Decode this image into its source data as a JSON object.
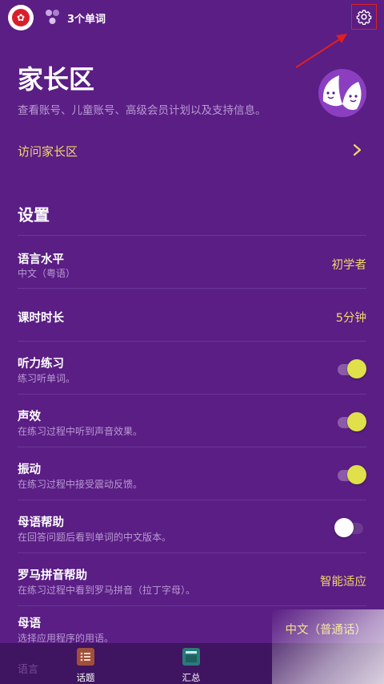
{
  "topbar": {
    "flag_glyph": "✿",
    "words_count": "3个单词",
    "icons": [
      "flag-icon",
      "words-icon",
      "gear-icon"
    ]
  },
  "parent": {
    "title": "家长区",
    "description": "查看账号、儿童账号、高级会员计划以及支持信息。",
    "link_label": "访问家长区"
  },
  "settings": {
    "title": "设置",
    "rows": [
      {
        "title": "语言水平",
        "subtitle": "中文（粤语）",
        "value": "初学者"
      },
      {
        "title": "课时时长",
        "subtitle": "",
        "value": "5分钟"
      },
      {
        "title": "听力练习",
        "subtitle": "练习听单词。",
        "toggle": true
      },
      {
        "title": "声效",
        "subtitle": "在练习过程中听到声音效果。",
        "toggle": true
      },
      {
        "title": "振动",
        "subtitle": "在练习过程中接受震动反馈。",
        "toggle": true
      },
      {
        "title": "母语帮助",
        "subtitle": "在回答问题后看到单词的中文版本。",
        "toggle": false
      },
      {
        "title": "罗马拼音帮助",
        "subtitle": "在练习过程中看到罗马拼音（拉丁字母）。",
        "value": "智能适应"
      },
      {
        "title": "母语",
        "subtitle": "选择应用程序的用语。",
        "value": "中文（普通话）"
      }
    ]
  },
  "bottom_nav": {
    "tabs": [
      {
        "label": "话题",
        "icon": "topics-icon"
      },
      {
        "label": "汇总",
        "icon": "summary-icon"
      }
    ],
    "partial_label": "语言"
  },
  "colors": {
    "background": "#5a1e84",
    "accent_yellow": "#f2d66b",
    "toggle_on": "#dfe04a",
    "annotation_red": "#e02020"
  }
}
